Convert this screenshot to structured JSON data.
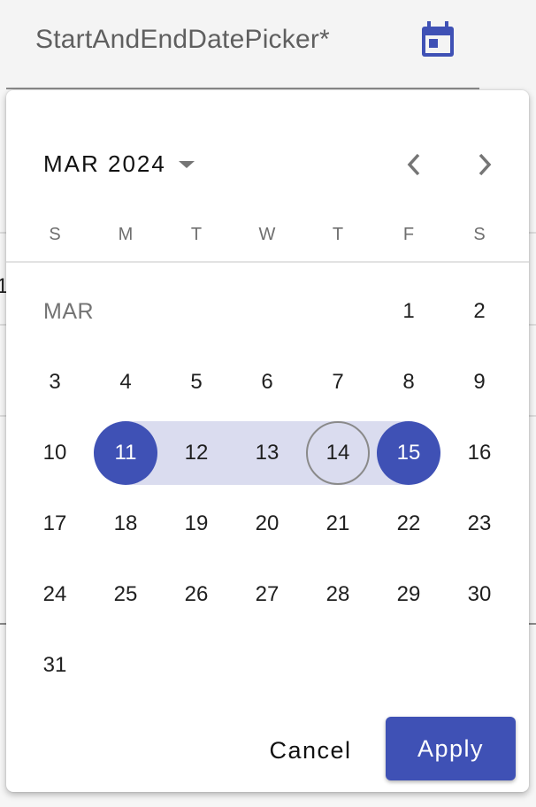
{
  "field": {
    "label": "StartAndEndDatePicker*",
    "icon": "calendar-icon"
  },
  "background": {
    "partial_cell_text": "1"
  },
  "picker": {
    "header": {
      "month_year": "MAR 2024",
      "dropdown_icon": "caret-down-icon",
      "prev_icon": "chevron-left-icon",
      "next_icon": "chevron-right-icon"
    },
    "weekdays": [
      "S",
      "M",
      "T",
      "W",
      "T",
      "F",
      "S"
    ],
    "month_label": "MAR",
    "weeks": [
      [
        null,
        null,
        null,
        null,
        null,
        "1",
        "2"
      ],
      [
        "3",
        "4",
        "5",
        "6",
        "7",
        "8",
        "9"
      ],
      [
        "10",
        "11",
        "12",
        "13",
        "14",
        "15",
        "16"
      ],
      [
        "17",
        "18",
        "19",
        "20",
        "21",
        "22",
        "23"
      ],
      [
        "24",
        "25",
        "26",
        "27",
        "28",
        "29",
        "30"
      ],
      [
        "31",
        null,
        null,
        null,
        null,
        null,
        null
      ]
    ],
    "range_start": "11",
    "range_end": "15",
    "today": "14",
    "colors": {
      "accent": "#3f51b5",
      "range_fill": "#dadcef",
      "today_ring": "#8a8a8a"
    },
    "actions": {
      "cancel_label": "Cancel",
      "apply_label": "Apply"
    }
  }
}
